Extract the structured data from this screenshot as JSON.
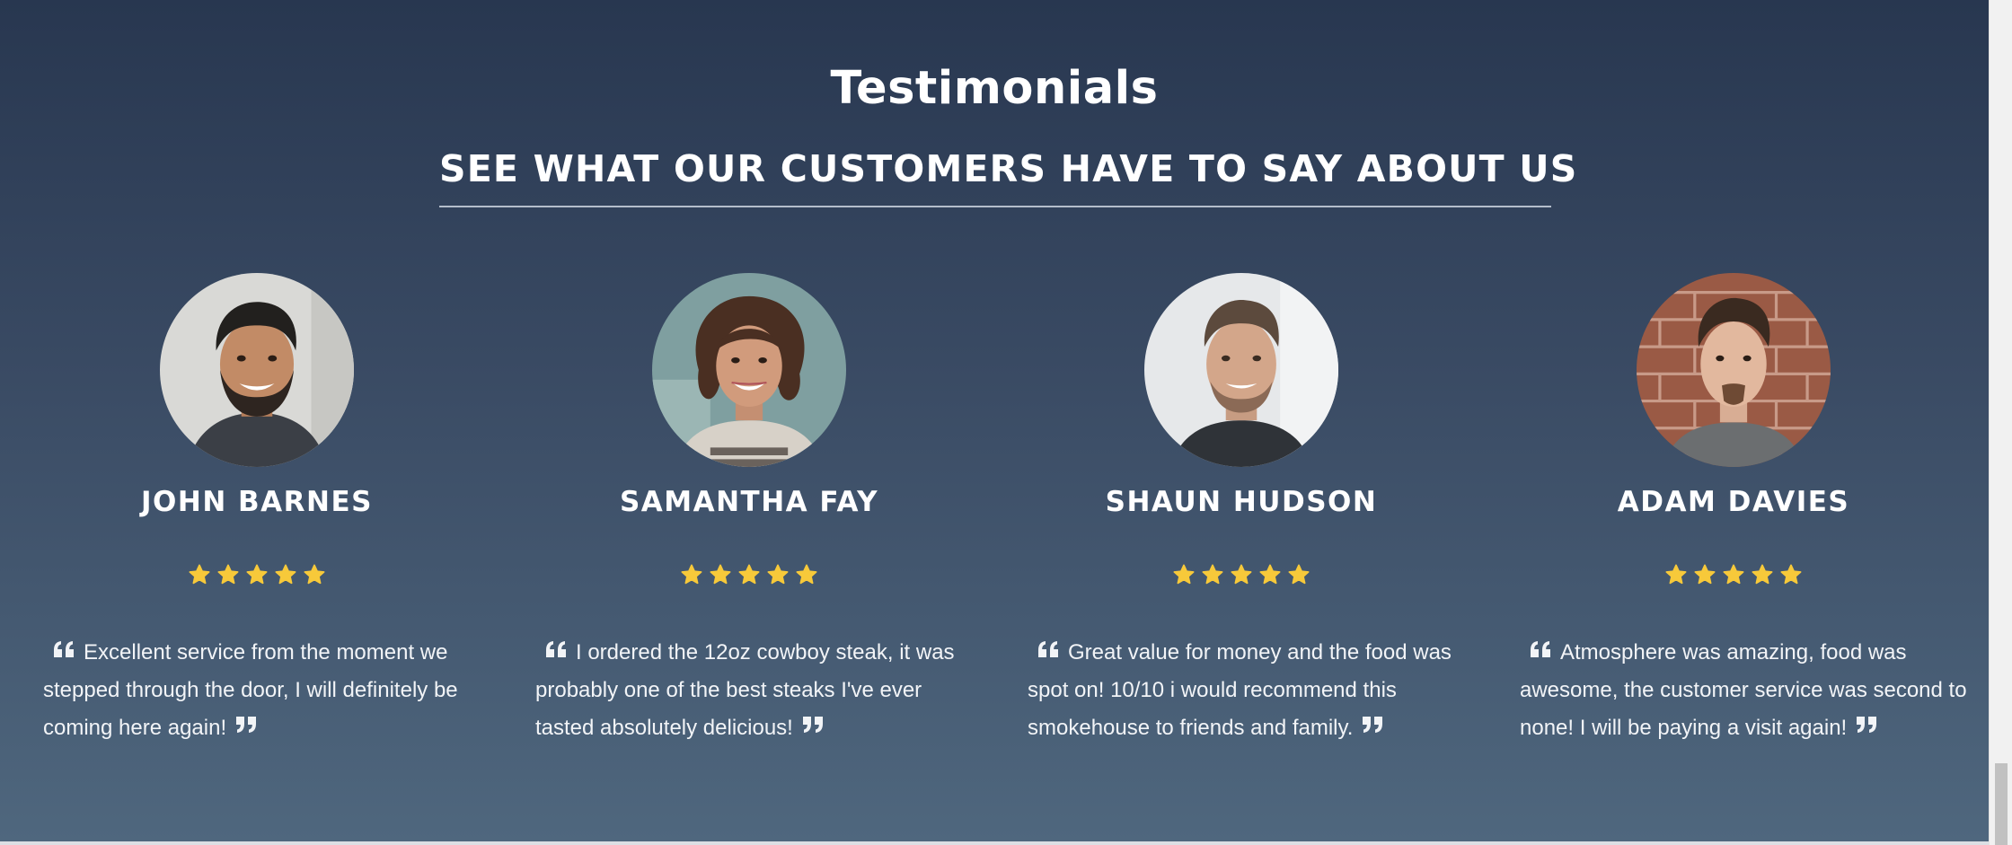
{
  "section": {
    "title": "Testimonials",
    "subtitle": "SEE WHAT OUR CUSTOMERS HAVE TO SAY ABOUT US"
  },
  "colors": {
    "background_top": "#283750",
    "background_bottom": "#4f677e",
    "text": "#ffffff",
    "star": "#f7c93a"
  },
  "icons": {
    "rating": "star-icon",
    "quote_open": "quote-left-icon",
    "quote_close": "quote-right-icon"
  },
  "testimonials": [
    {
      "name": "JOHN BARNES",
      "rating": 5,
      "quote": "Excellent service from the moment we stepped through the door, I will definitely be coming here again!"
    },
    {
      "name": "SAMANTHA FAY",
      "rating": 5,
      "quote": "I ordered the 12oz cowboy steak, it was probably one of the best steaks I've ever tasted absolutely delicious!"
    },
    {
      "name": "SHAUN HUDSON",
      "rating": 5,
      "quote": "Great value for money and the food was spot on! 10/10 i would recommend this smokehouse to friends and family."
    },
    {
      "name": "ADAM DAVIES",
      "rating": 5,
      "quote": "Atmosphere was amazing, food was awesome, the customer service was second to none! I will be paying a visit again!"
    }
  ]
}
